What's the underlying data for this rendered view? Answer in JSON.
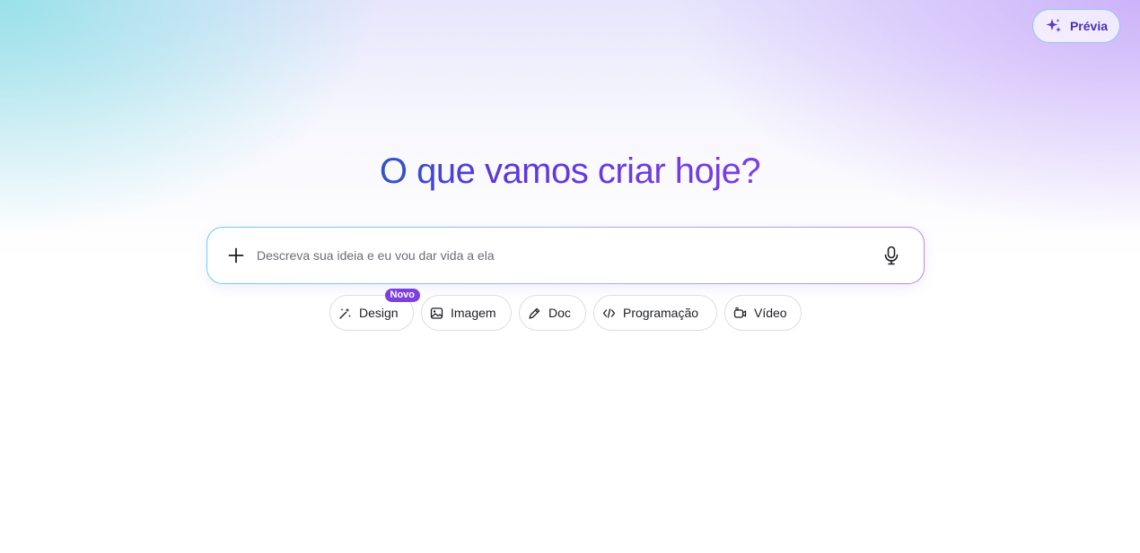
{
  "header": {
    "preview_button": {
      "label": "Prévia",
      "icon": "sparkle-icon"
    }
  },
  "hero": {
    "title": "O que vamos criar hoje?"
  },
  "prompt": {
    "placeholder": "Descreva sua ideia e eu vou dar vida a ela",
    "value": "",
    "add_icon": "plus-icon",
    "mic_icon": "microphone-icon"
  },
  "chips": {
    "design": {
      "label": "Design",
      "icon": "magic-wand-icon",
      "badge": "Novo"
    },
    "imagem": {
      "label": "Imagem",
      "icon": "image-icon"
    },
    "doc": {
      "label": "Doc",
      "icon": "pen-icon"
    },
    "programacao": {
      "label": "Programação",
      "icon": "code-icon"
    },
    "video": {
      "label": "Vídeo",
      "icon": "video-camera-icon"
    }
  },
  "colors": {
    "accent": "#7b3fe4",
    "title_gradient_start": "#2f55c8",
    "title_gradient_end": "#7a3fe6",
    "preview_text": "#4b2fb8"
  }
}
